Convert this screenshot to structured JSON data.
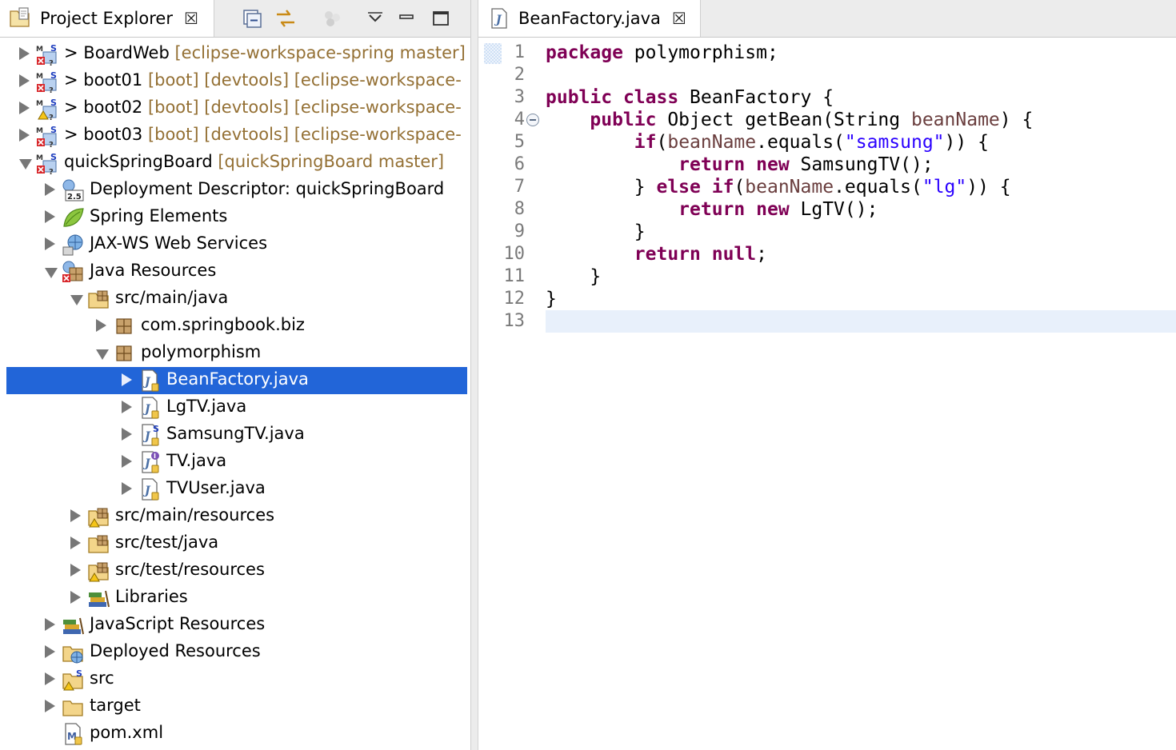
{
  "explorer": {
    "title": "Project Explorer",
    "close_glyph": "☒",
    "toolbar": [
      {
        "name": "collapse-all-icon"
      },
      {
        "name": "link-with-editor-icon"
      },
      {
        "name": "focus-active-task-icon"
      },
      {
        "name": "view-menu-icon"
      },
      {
        "name": "minimize-icon"
      },
      {
        "name": "maximize-icon"
      }
    ],
    "rows": [
      {
        "label": "BoardWeb",
        "prefix": "> ",
        "deco": "[eclipse-workspace-spring master]",
        "depth": 0,
        "twisty": "r",
        "icon": "maven-spring-error-project-icon"
      },
      {
        "label": "boot01",
        "prefix": "> ",
        "deco": "[boot] [devtools] [eclipse-workspace-",
        "depth": 0,
        "twisty": "r",
        "icon": "maven-spring-error-project-icon"
      },
      {
        "label": "boot02",
        "prefix": "> ",
        "deco": "[boot] [devtools] [eclipse-workspace-",
        "depth": 0,
        "twisty": "r",
        "icon": "maven-spring-warning-project-icon"
      },
      {
        "label": "boot03",
        "prefix": "> ",
        "deco": "[boot] [devtools] [eclipse-workspace-",
        "depth": 0,
        "twisty": "r",
        "icon": "maven-spring-error-project-icon"
      },
      {
        "label": "quickSpringBoard",
        "prefix": "",
        "deco": "[quickSpringBoard master]",
        "depth": 0,
        "twisty": "d",
        "icon": "maven-spring-error-project-icon"
      },
      {
        "label": "Deployment Descriptor: quickSpringBoard",
        "prefix": "",
        "deco": "",
        "depth": 1,
        "twisty": "r",
        "icon": "deployment-descriptor-icon"
      },
      {
        "label": "Spring Elements",
        "prefix": "",
        "deco": "",
        "depth": 1,
        "twisty": "r",
        "icon": "spring-leaf-icon"
      },
      {
        "label": "JAX-WS Web Services",
        "prefix": "",
        "deco": "",
        "depth": 1,
        "twisty": "r",
        "icon": "web-services-icon"
      },
      {
        "label": "Java Resources",
        "prefix": "",
        "deco": "",
        "depth": 1,
        "twisty": "d",
        "icon": "java-resources-icon"
      },
      {
        "label": "src/main/java",
        "prefix": "",
        "deco": "",
        "depth": 2,
        "twisty": "d",
        "icon": "source-folder-icon"
      },
      {
        "label": "com.springbook.biz",
        "prefix": "",
        "deco": "",
        "depth": 3,
        "twisty": "r",
        "icon": "package-icon"
      },
      {
        "label": "polymorphism",
        "prefix": "",
        "deco": "",
        "depth": 3,
        "twisty": "d",
        "icon": "package-icon"
      },
      {
        "label": "BeanFactory.java",
        "prefix": "",
        "deco": "",
        "depth": 4,
        "twisty": "r",
        "icon": "java-file-icon",
        "selected": true
      },
      {
        "label": "LgTV.java",
        "prefix": "",
        "deco": "",
        "depth": 4,
        "twisty": "r",
        "icon": "java-file-icon"
      },
      {
        "label": "SamsungTV.java",
        "prefix": "",
        "deco": "",
        "depth": 4,
        "twisty": "r",
        "icon": "java-spring-file-icon"
      },
      {
        "label": "TV.java",
        "prefix": "",
        "deco": "",
        "depth": 4,
        "twisty": "r",
        "icon": "java-interface-file-icon"
      },
      {
        "label": "TVUser.java",
        "prefix": "",
        "deco": "",
        "depth": 4,
        "twisty": "r",
        "icon": "java-file-icon"
      },
      {
        "label": "src/main/resources",
        "prefix": "",
        "deco": "",
        "depth": 2,
        "twisty": "r",
        "icon": "source-folder-warning-icon"
      },
      {
        "label": "src/test/java",
        "prefix": "",
        "deco": "",
        "depth": 2,
        "twisty": "r",
        "icon": "source-folder-icon"
      },
      {
        "label": "src/test/resources",
        "prefix": "",
        "deco": "",
        "depth": 2,
        "twisty": "r",
        "icon": "source-folder-warning-icon"
      },
      {
        "label": "Libraries",
        "prefix": "",
        "deco": "",
        "depth": 2,
        "twisty": "r",
        "icon": "libraries-icon"
      },
      {
        "label": "JavaScript Resources",
        "prefix": "",
        "deco": "",
        "depth": 1,
        "twisty": "r",
        "icon": "libraries-icon"
      },
      {
        "label": "Deployed Resources",
        "prefix": "",
        "deco": "",
        "depth": 1,
        "twisty": "r",
        "icon": "deployed-resources-icon"
      },
      {
        "label": "src",
        "prefix": "",
        "deco": "",
        "depth": 1,
        "twisty": "r",
        "icon": "folder-spring-warning-icon"
      },
      {
        "label": "target",
        "prefix": "",
        "deco": "",
        "depth": 1,
        "twisty": "r",
        "icon": "folder-icon"
      },
      {
        "label": "pom.xml",
        "prefix": "",
        "deco": "",
        "depth": 1,
        "twisty": "",
        "icon": "maven-pom-icon"
      }
    ]
  },
  "editor": {
    "tab_title": "BeanFactory.java",
    "close_glyph": "☒",
    "line_numbers": [
      "1",
      "2",
      "3",
      "4",
      "5",
      "6",
      "7",
      "8",
      "9",
      "10",
      "11",
      "12",
      "13"
    ],
    "lines": [
      [
        {
          "t": "package",
          "c": "kw"
        },
        {
          "t": " polymorphism;"
        }
      ],
      [],
      [
        {
          "t": "public",
          "c": "kw"
        },
        {
          "t": " "
        },
        {
          "t": "class",
          "c": "kw"
        },
        {
          "t": " BeanFactory {"
        }
      ],
      [
        {
          "t": "    "
        },
        {
          "t": "public",
          "c": "kw"
        },
        {
          "t": " Object getBean(String "
        },
        {
          "t": "beanName",
          "c": "var"
        },
        {
          "t": ") {"
        }
      ],
      [
        {
          "t": "        "
        },
        {
          "t": "if",
          "c": "kw"
        },
        {
          "t": "("
        },
        {
          "t": "beanName",
          "c": "var"
        },
        {
          "t": ".equals("
        },
        {
          "t": "\"samsung\"",
          "c": "str"
        },
        {
          "t": ")) {"
        }
      ],
      [
        {
          "t": "            "
        },
        {
          "t": "return",
          "c": "kw"
        },
        {
          "t": " "
        },
        {
          "t": "new",
          "c": "kw"
        },
        {
          "t": " SamsungTV();"
        }
      ],
      [
        {
          "t": "        } "
        },
        {
          "t": "else",
          "c": "kw"
        },
        {
          "t": " "
        },
        {
          "t": "if",
          "c": "kw"
        },
        {
          "t": "("
        },
        {
          "t": "beanName",
          "c": "var"
        },
        {
          "t": ".equals("
        },
        {
          "t": "\"lg\"",
          "c": "str"
        },
        {
          "t": ")) {"
        }
      ],
      [
        {
          "t": "            "
        },
        {
          "t": "return",
          "c": "kw"
        },
        {
          "t": " "
        },
        {
          "t": "new",
          "c": "kw"
        },
        {
          "t": " LgTV();"
        }
      ],
      [
        {
          "t": "        }"
        }
      ],
      [
        {
          "t": "        "
        },
        {
          "t": "return",
          "c": "kw"
        },
        {
          "t": " "
        },
        {
          "t": "null",
          "c": "kw"
        },
        {
          "t": ";"
        }
      ],
      [
        {
          "t": "    }"
        }
      ],
      [
        {
          "t": "}"
        }
      ],
      []
    ],
    "fold_line": 4,
    "current_line": 13
  },
  "colors": {
    "keyword": "#7f0055",
    "string": "#2a00ff",
    "parameter": "#6a3e3e",
    "selection": "#2265d8",
    "decoration": "#947034"
  }
}
